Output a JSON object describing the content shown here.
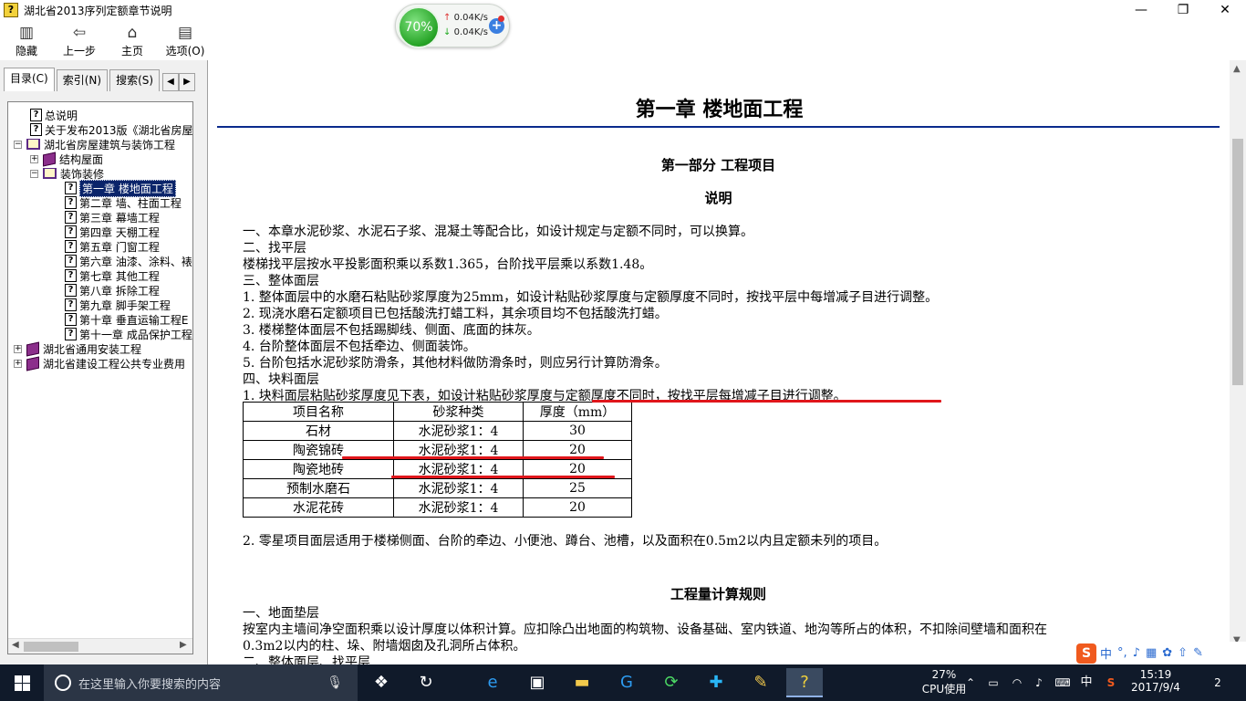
{
  "window": {
    "title": "湖北省2013序列定额章节说明",
    "minimize": "—",
    "restore": "❐",
    "close": "✕"
  },
  "toolbar": {
    "hide": "隐藏",
    "back": "上一步",
    "home": "主页",
    "options": "选项(O)"
  },
  "net_widget": {
    "percent": "70%",
    "up": "0.04K/s",
    "down": "0.04K/s"
  },
  "left_tabs": [
    "目录(C)",
    "索引(N)",
    "搜索(S)"
  ],
  "tree": [
    {
      "label": "总说明",
      "icon": "help-page-icon",
      "level": 1
    },
    {
      "label": "关于发布2013版《湖北省房屋",
      "icon": "help-page-icon",
      "level": 1
    },
    {
      "label": "湖北省房屋建筑与装饰工程",
      "icon": "open-book-icon",
      "level": 0,
      "expander": "−"
    },
    {
      "label": "结构屋面",
      "icon": "closed-book-icon",
      "level": 1,
      "expander": "+"
    },
    {
      "label": "装饰装修",
      "icon": "open-book-icon",
      "level": 1,
      "expander": "−"
    },
    {
      "label": "第一章 楼地面工程",
      "icon": "help-page-icon",
      "level": 2,
      "selected": true
    },
    {
      "label": "第二章 墙、柱面工程",
      "icon": "help-page-icon",
      "level": 2
    },
    {
      "label": "第三章 幕墙工程",
      "icon": "help-page-icon",
      "level": 2
    },
    {
      "label": "第四章 天棚工程",
      "icon": "help-page-icon",
      "level": 2
    },
    {
      "label": "第五章 门窗工程",
      "icon": "help-page-icon",
      "level": 2
    },
    {
      "label": "第六章 油漆、涂料、裱",
      "icon": "help-page-icon",
      "level": 2
    },
    {
      "label": "第七章 其他工程",
      "icon": "help-page-icon",
      "level": 2
    },
    {
      "label": "第八章 拆除工程",
      "icon": "help-page-icon",
      "level": 2
    },
    {
      "label": "第九章 脚手架工程",
      "icon": "help-page-icon",
      "level": 2
    },
    {
      "label": "第十章 垂直运输工程E",
      "icon": "help-page-icon",
      "level": 2
    },
    {
      "label": "第十一章 成品保护工程",
      "icon": "help-page-icon",
      "level": 2
    },
    {
      "label": "湖北省通用安装工程",
      "icon": "closed-book-icon",
      "level": 0,
      "expander": "+"
    },
    {
      "label": "湖北省建设工程公共专业费用",
      "icon": "closed-book-icon",
      "level": 0,
      "expander": "+"
    }
  ],
  "content": {
    "chapter_title": "第一章 楼地面工程",
    "part_title": "第一部分 工程项目",
    "explanation_title": "说明",
    "lines": [
      "一、本章水泥砂浆、水泥石子浆、混凝土等配合比，如设计规定与定额不同时，可以换算。",
      "二、找平层",
      "楼梯找平层按水平投影面积乘以系数1.365，台阶找平层乘以系数1.48。",
      "三、整体面层",
      "1. 整体面层中的水磨石粘贴砂浆厚度为25mm，如设计粘贴砂浆厚度与定额厚度不同时，按找平层中每增减子目进行调整。",
      "2. 现浇水磨石定额项目已包括酸洗打蜡工料，其余项目均不包括酸洗打蜡。",
      "3. 楼梯整体面层不包括踢脚线、侧面、底面的抹灰。",
      "4. 台阶整体面层不包括牵边、侧面装饰。",
      "5. 台阶包括水泥砂浆防滑条，其他材料做防滑条时，则应另行计算防滑条。",
      "四、块料面层",
      "1. 块料面层粘贴砂浆厚度见下表，如设计粘贴砂浆厚度与定额厚度不同时，按找平层每增减子目进行调整。"
    ],
    "table": {
      "headers": [
        "项目名称",
        "砂浆种类",
        "厚度（mm）"
      ],
      "rows": [
        [
          "石材",
          "水泥砂浆1：4",
          "30"
        ],
        [
          "陶瓷锦砖",
          "水泥砂浆1：4",
          "20"
        ],
        [
          "陶瓷地砖",
          "水泥砂浆1：4",
          "20"
        ],
        [
          "预制水磨石",
          "水泥砂浆1：4",
          "25"
        ],
        [
          "水泥花砖",
          "水泥砂浆1：4",
          "20"
        ]
      ]
    },
    "after_table": "2. 零星项目面层适用于楼梯侧面、台阶的牵边、小便池、蹲台、池槽，以及面积在0.5m2以内且定额未列的项目。",
    "section_title": "工程量计算规则",
    "rule_lines": [
      "一、地面垫层",
      "按室内主墙间净空面积乘以设计厚度以体积计算。应扣除凸出地面的构筑物、设备基础、室内铁道、地沟等所占的体积，不扣除间壁墙和面积在",
      "0.3m2以内的柱、垛、附墙烟囱及孔洞所占体积。",
      "二、整体面层、找平层"
    ]
  },
  "ime": {
    "lang": "中",
    "punct": "°,"
  },
  "taskbar": {
    "search_placeholder": "在这里输入你要搜索的内容",
    "cpu_percent": "27%",
    "cpu_label": "CPU使用",
    "ime_lang": "中",
    "time": "15:19",
    "date": "2017/9/4",
    "notifications": "2"
  }
}
